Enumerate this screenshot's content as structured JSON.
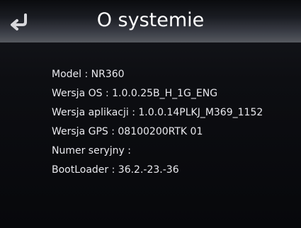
{
  "header": {
    "title": "O systemie",
    "back_icon": "return-arrow-icon"
  },
  "info": {
    "model": "Model : NR360",
    "os_version": "Wersja OS : 1.0.0.25B_H_1G_ENG",
    "app_version": "Wersja aplikacji : 1.0.0.14PLKJ_M369_1152",
    "gps_version": "Wersja GPS : 08100200RTK 01",
    "serial_number": "Numer seryjny :",
    "bootloader": "BootLoader : 36.2.-23.-36"
  },
  "colors": {
    "text": "#e9e9ee",
    "title": "#ffffff",
    "background": "#0b0c10"
  }
}
